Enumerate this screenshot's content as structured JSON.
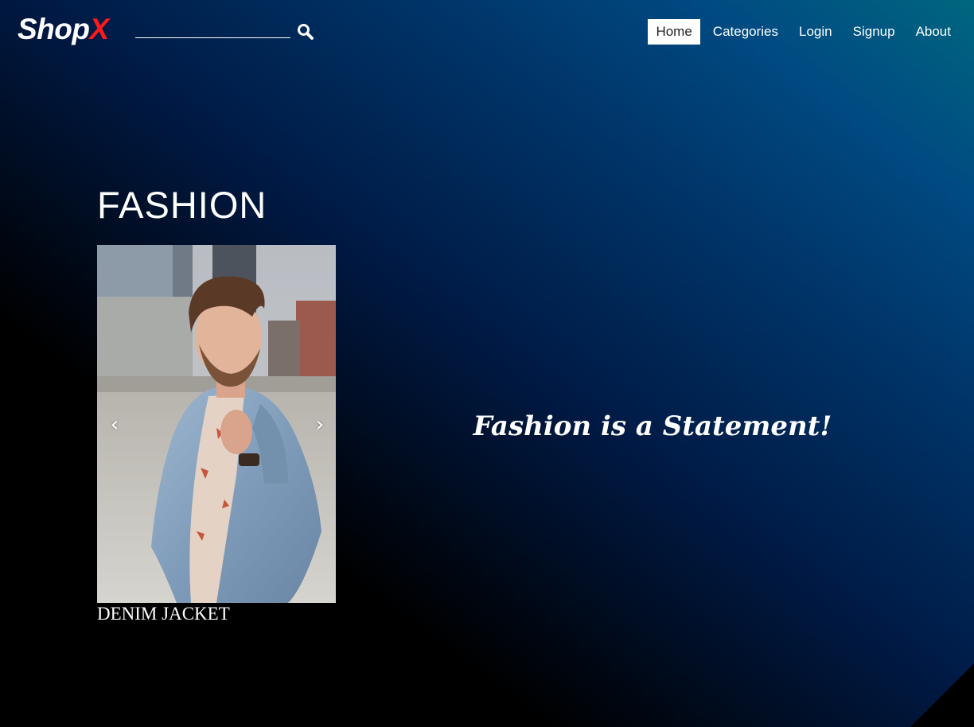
{
  "header": {
    "logo_main": "Shop",
    "logo_accent": "X",
    "search": {
      "value": "",
      "placeholder": ""
    },
    "nav": [
      {
        "label": "Home",
        "active": true
      },
      {
        "label": "Categories",
        "active": false
      },
      {
        "label": "Login",
        "active": false
      },
      {
        "label": "Signup",
        "active": false
      },
      {
        "label": "About",
        "active": false
      }
    ]
  },
  "hero": {
    "section_title": "FASHION",
    "carousel": {
      "prev_glyph": "‹",
      "next_glyph": "›",
      "caption": "DENIM JACKET"
    },
    "tagline": "Fashion is a Statement!"
  },
  "colors": {
    "logo_accent": "#ff1a1a",
    "active_nav_bg": "#ffffff",
    "active_nav_text": "#222222",
    "gradient_dark": "#000000",
    "gradient_light": "#00667f"
  },
  "icons": {
    "search": "search-icon",
    "prev": "chevron-left-icon",
    "next": "chevron-right-icon"
  }
}
